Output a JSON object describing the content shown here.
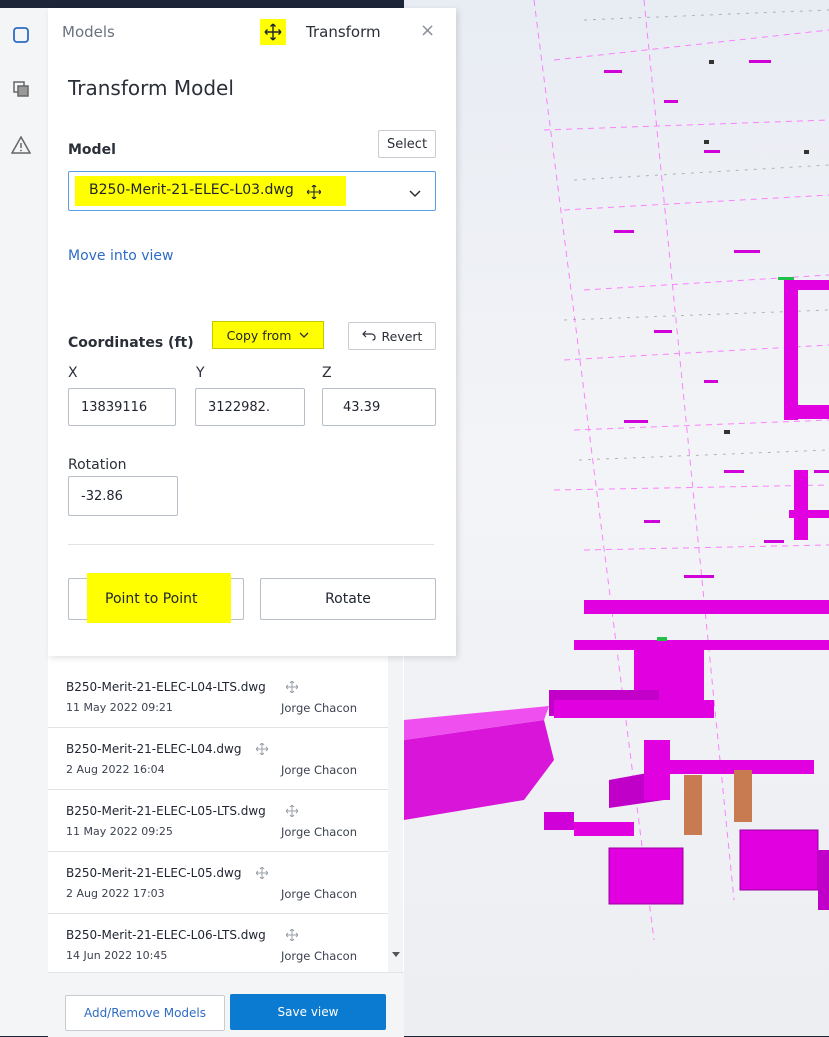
{
  "rail": {
    "icons": [
      "cube-icon",
      "layers-icon",
      "warning-icon"
    ]
  },
  "transform_panel": {
    "tab_models": "Models",
    "tab_transform": "Transform",
    "close": "×",
    "title": "Transform Model",
    "model_label": "Model",
    "select_label": "Select",
    "model_value": "B250-Merit-21-ELEC-L03.dwg",
    "move_into_view": "Move into view",
    "coordinates_label": "Coordinates (ft)",
    "copy_from_label": "Copy from",
    "revert_label": "Revert",
    "x_label": "X",
    "y_label": "Y",
    "z_label": "Z",
    "x_value": "13839116",
    "y_value": "3122982.",
    "z_value": "43.39",
    "rotation_label": "Rotation",
    "rotation_value": "-32.86",
    "point_to_point_label": "Point to Point",
    "rotate_label": "Rotate"
  },
  "model_list": [
    {
      "name": "B250-Merit-21-ELEC-L04-LTS.dwg",
      "date": "11 May 2022 09:21",
      "user": "Jorge Chacon"
    },
    {
      "name": "B250-Merit-21-ELEC-L04.dwg",
      "date": "2 Aug 2022 16:04",
      "user": "Jorge Chacon"
    },
    {
      "name": "B250-Merit-21-ELEC-L05-LTS.dwg",
      "date": "11 May 2022 09:25",
      "user": "Jorge Chacon"
    },
    {
      "name": "B250-Merit-21-ELEC-L05.dwg",
      "date": "2 Aug 2022 17:03",
      "user": "Jorge Chacon"
    },
    {
      "name": "B250-Merit-21-ELEC-L06-LTS.dwg",
      "date": "14 Jun 2022 10:45",
      "user": "Jorge Chacon"
    }
  ],
  "footer": {
    "add_remove_label": "Add/Remove Models",
    "save_view_label": "Save view"
  },
  "colors": {
    "highlight": "#ffff00",
    "accent": "#0a7bd1",
    "model_geometry": "#e000e0"
  }
}
